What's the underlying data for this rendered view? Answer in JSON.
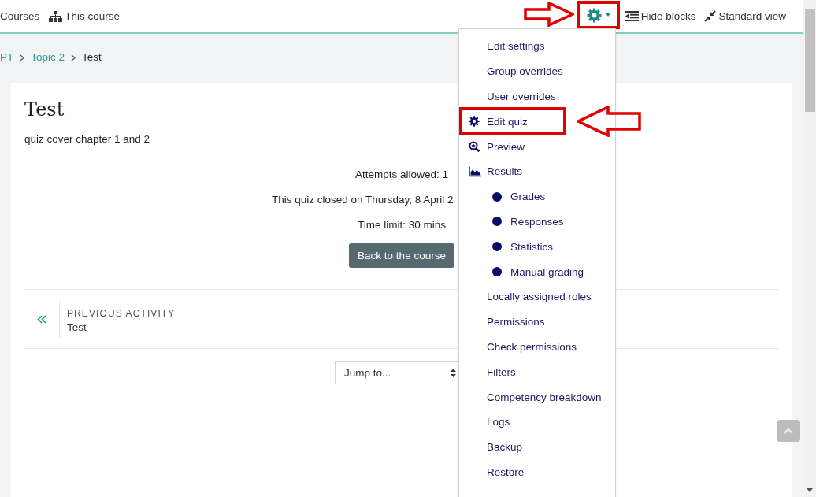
{
  "navbar": {
    "left_links": [
      {
        "label": "Courses",
        "kind": "plain"
      },
      {
        "label": "This course",
        "kind": "course"
      }
    ],
    "settings_button": {
      "annotated": true
    },
    "actions": [
      {
        "label": "Hide blocks",
        "kind": "blocks"
      },
      {
        "label": "Standard view",
        "kind": "view"
      }
    ]
  },
  "breadcrumb": [
    {
      "label": "PT",
      "link": true
    },
    {
      "label": "Topic 2",
      "link": true
    },
    {
      "label": "Test",
      "link": false
    }
  ],
  "content": {
    "title": "Test",
    "description": "quiz cover chapter 1 and 2",
    "info": [
      {
        "text": "Attempts allowed: 1",
        "clipped": false
      },
      {
        "text": "This quiz closed on Thursday, 8 April 2",
        "clipped": true
      },
      {
        "text": "Time limit: 30 mins",
        "clipped": false
      }
    ],
    "back_button": "Back to the course",
    "previous_activity": {
      "label": "PREVIOUS ACTIVITY",
      "name": "Test"
    },
    "jump_select": {
      "value": "Jump to..."
    }
  },
  "settings_menu": {
    "items": [
      {
        "label": "Edit settings",
        "kind": "link",
        "annotated": false
      },
      {
        "label": "Group overrides",
        "kind": "link",
        "annotated": false
      },
      {
        "label": "User overrides",
        "kind": "link",
        "annotated": false
      },
      {
        "label": "Edit quiz",
        "kind": "edit",
        "annotated": true
      },
      {
        "label": "Preview",
        "kind": "preview",
        "annotated": false
      },
      {
        "label": "Results",
        "kind": "report",
        "annotated": false,
        "children": [
          {
            "label": "Grades",
            "annotated": false
          },
          {
            "label": "Responses",
            "annotated": false
          },
          {
            "label": "Statistics",
            "annotated": false
          },
          {
            "label": "Manual grading",
            "annotated": false
          }
        ]
      },
      {
        "label": "Locally assigned roles",
        "kind": "link",
        "annotated": false
      },
      {
        "label": "Permissions",
        "kind": "link",
        "annotated": false
      },
      {
        "label": "Check permissions",
        "kind": "link",
        "annotated": false
      },
      {
        "label": "Filters",
        "kind": "link",
        "annotated": false
      },
      {
        "label": "Competency breakdown",
        "kind": "link",
        "annotated": false
      },
      {
        "label": "Logs",
        "kind": "link",
        "annotated": false
      },
      {
        "label": "Backup",
        "kind": "link",
        "annotated": false
      },
      {
        "label": "Restore",
        "kind": "link",
        "annotated": false
      }
    ]
  }
}
